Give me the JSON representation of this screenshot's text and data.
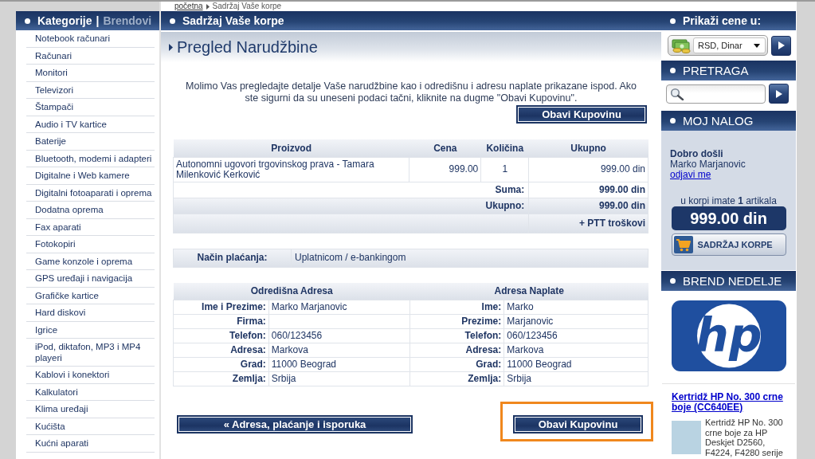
{
  "breadcrumb": {
    "link": "početna",
    "current": "Sadržaj Vaše korpe"
  },
  "sidebar": {
    "tabs": [
      {
        "label": "Kategorije",
        "selected": true
      },
      {
        "label": "Brendovi",
        "selected": false
      }
    ],
    "separator": "|",
    "items": [
      "Notebook računari",
      "Računari",
      "Monitori",
      "Televizori",
      "Štampači",
      "Audio i TV kartice",
      "Baterije",
      "Bluetooth, modemi i adapteri",
      "Digitalne i Web kamere",
      "Digitalni fotoaparati i oprema",
      "Dodatna oprema",
      "Fax aparati",
      "Fotokopiri",
      "Game konzole i oprema",
      "GPS uređaji i navigacija",
      "Grafičke kartice",
      "Hard diskovi",
      "Igrice",
      "iPod, diktafon, MP3 i MP4 playeri",
      "Kablovi i konektori",
      "Kalkulatori",
      "Klima uređaji",
      "Kućišta",
      "Kućni aparati"
    ]
  },
  "main": {
    "title": "Sadržaj Vaše korpe",
    "heading": "Pregled Narudžbine",
    "intro": "Molimo Vas pregledajte detalje Vaše narudžbine kao i odredišnu i adresu naplate prikazane ispod. Ako ste sigurni da su uneseni podaci tačni, kliknite na dugme \"Obavi Kupovinu\".",
    "top_button": "Obavi Kupovinu",
    "products": {
      "columns": [
        "Proizvod",
        "Cena",
        "Količina",
        "Ukupno"
      ],
      "rows": [
        {
          "product": "Autonomni ugovori trgovinskog prava - Tamara Milenković Kerković",
          "price": "999.00",
          "quantity": "1",
          "total": "999.00 din"
        }
      ],
      "summary": [
        {
          "kind": "subtotal",
          "label": "Suma:",
          "value": "999.00 din"
        },
        {
          "kind": "total",
          "label": "Ukupno:",
          "value": "999.00 din"
        },
        {
          "kind": "note",
          "value": "+ PTT troškovi"
        }
      ]
    },
    "payment": {
      "label": "Način plaćanja:",
      "value": "Uplatnicom / e-bankingom"
    },
    "addresses": [
      {
        "title": "Odredišna Adresa",
        "rows": [
          {
            "label": "Ime i Prezime:",
            "value": "Marko Marjanovic"
          },
          {
            "label": "Firma:"
          },
          {
            "label": "Telefon:",
            "value": "060/123456"
          },
          {
            "label": "Adresa:",
            "value": "Markova"
          },
          {
            "label": "Grad:",
            "value": "11000 Beograd"
          },
          {
            "label": "Zemlja:",
            "value": "Srbija"
          }
        ]
      },
      {
        "title": "Adresa Naplate",
        "rows": [
          {
            "label": "Ime:",
            "value": "Marko"
          },
          {
            "label": "Prezime:",
            "value": "Marjanovic"
          },
          {
            "label": "Telefon:",
            "value": "060/123456"
          },
          {
            "label": "Adresa:",
            "value": "Markova"
          },
          {
            "label": "Grad:",
            "value": "11000 Beograd"
          },
          {
            "label": "Zemlja:",
            "value": "Srbija"
          }
        ]
      }
    ],
    "back_button": "« Adresa, plaćanje i isporuka",
    "confirm_button": {
      "label": "Obavi Kupovinu",
      "highlighted": true
    }
  },
  "currency": {
    "title": "Prikaži cene u:",
    "value": "RSD, Dinar"
  },
  "search": {
    "title": "PRETRAGA"
  },
  "account": {
    "title": "MOJ NALOG",
    "greeting": "Dobro došli",
    "user": "Marko Marjanovic",
    "logout": "odjavi me",
    "cart_note": "u korpi imate **1** artikala",
    "cart_total": "999.00 din",
    "cart_button": "SADRŽAJ KORPE"
  },
  "brand": {
    "title": "BREND NEDELJE",
    "logo": "hp",
    "product_link": "Kertridž HP No. 300 crne boje (CC640EE)",
    "product_description": "Kertridž HP No. 300 crne boje za HP Deskjet D2560, F4224, F4280 serije"
  }
}
